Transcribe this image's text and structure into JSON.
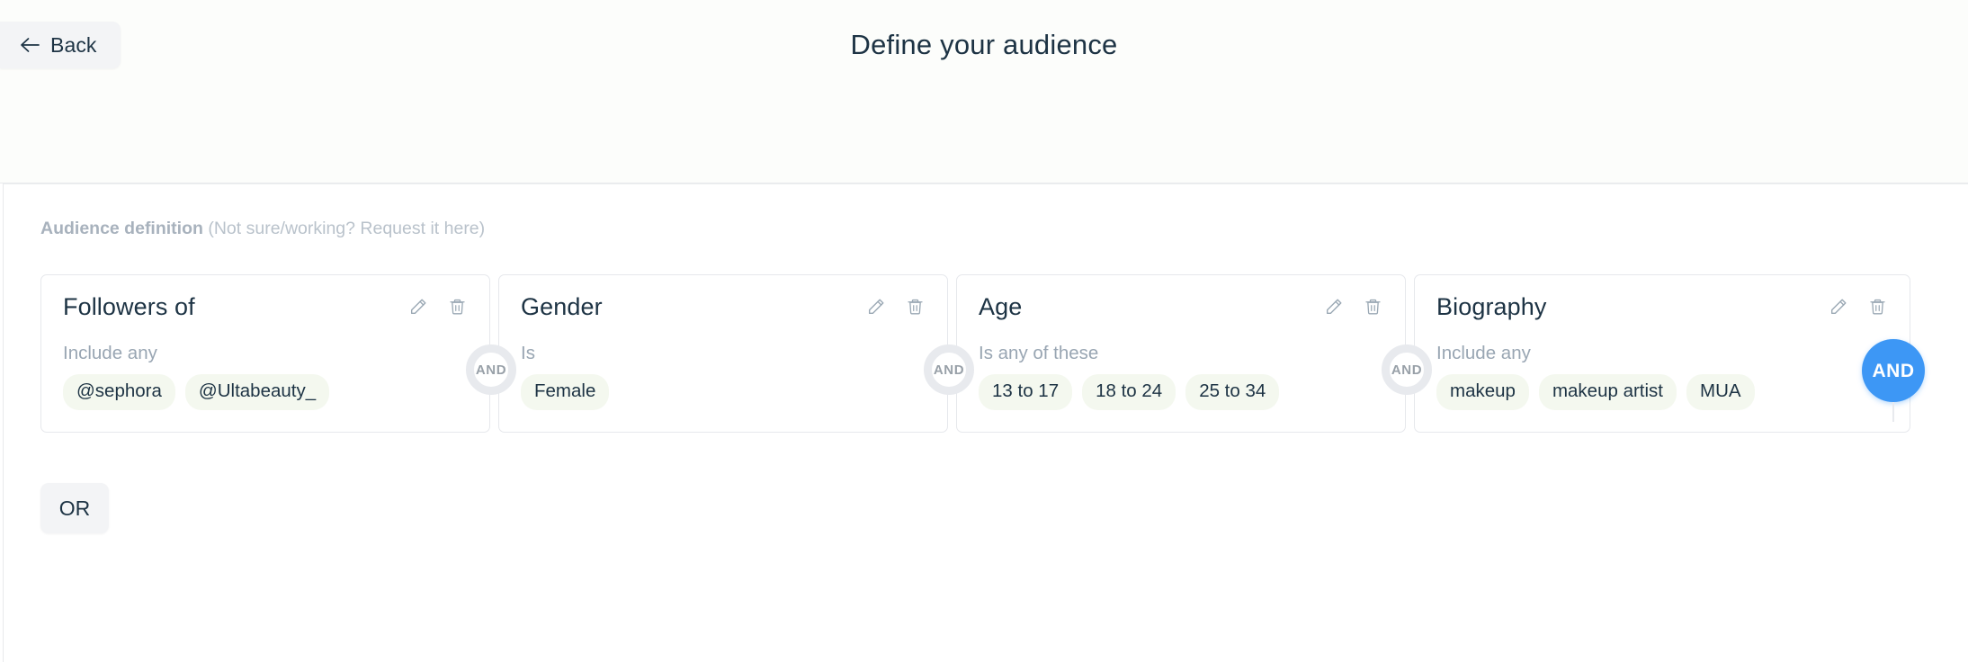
{
  "header": {
    "back_label": "Back",
    "back_icon": "arrow-left-icon",
    "title": "Define your audience"
  },
  "definition": {
    "label_strong": "Audience definition",
    "label_hint": "(Not sure/working? Request it here)"
  },
  "icons": {
    "edit": "pencil-icon",
    "delete": "trash-icon"
  },
  "connectors": {
    "and": "AND",
    "and_active": "AND"
  },
  "cards": [
    {
      "title": "Followers of",
      "operator": "Include any",
      "tags": [
        "@sephora",
        "@Ultabeauty_"
      ]
    },
    {
      "title": "Gender",
      "operator": "Is",
      "tags": [
        "Female"
      ]
    },
    {
      "title": "Age",
      "operator": "Is any of these",
      "tags": [
        "13 to 17",
        "18 to 24",
        "25 to 34"
      ]
    },
    {
      "title": "Biography",
      "operator": "Include any",
      "tags": [
        "makeup",
        "makeup artist",
        "MUA"
      ]
    }
  ],
  "or_button": {
    "label": "OR"
  },
  "colors": {
    "accent_blue": "#3d97f5",
    "text_dark": "#1d3344",
    "text_muted": "#99a6b3",
    "tag_bg": "#f4f8ef",
    "connector_ring": "#e8eaee"
  }
}
